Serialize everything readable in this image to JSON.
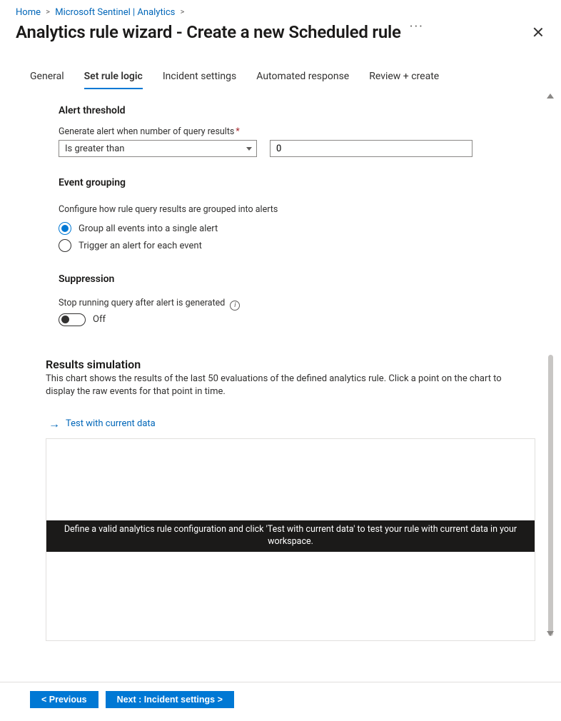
{
  "breadcrumb": {
    "items": [
      "Home",
      "Microsoft Sentinel | Analytics"
    ]
  },
  "title": "Analytics rule wizard - Create a new Scheduled rule",
  "tabs": [
    "General",
    "Set rule logic",
    "Incident settings",
    "Automated response",
    "Review + create"
  ],
  "active_tab_index": 1,
  "alert_threshold": {
    "heading": "Alert threshold",
    "label": "Generate alert when number of query results",
    "operator": "Is greater than",
    "value": "0"
  },
  "event_grouping": {
    "heading": "Event grouping",
    "description": "Configure how rule query results are grouped into alerts",
    "options": [
      "Group all events into a single alert",
      "Trigger an alert for each event"
    ],
    "selected_index": 0
  },
  "suppression": {
    "heading": "Suppression",
    "label": "Stop running query after alert is generated",
    "state_text": "Off"
  },
  "simulation": {
    "heading": "Results simulation",
    "description": "This chart shows the results of the last 50 evaluations of the defined analytics rule. Click a point on the chart to display the raw events for that point in time.",
    "test_link": "Test with current data",
    "banner": "Define a valid analytics rule configuration and click 'Test with current data' to test your rule with current data in your workspace."
  },
  "footer": {
    "prev": "<  Previous",
    "next": "Next : Incident settings  >"
  }
}
